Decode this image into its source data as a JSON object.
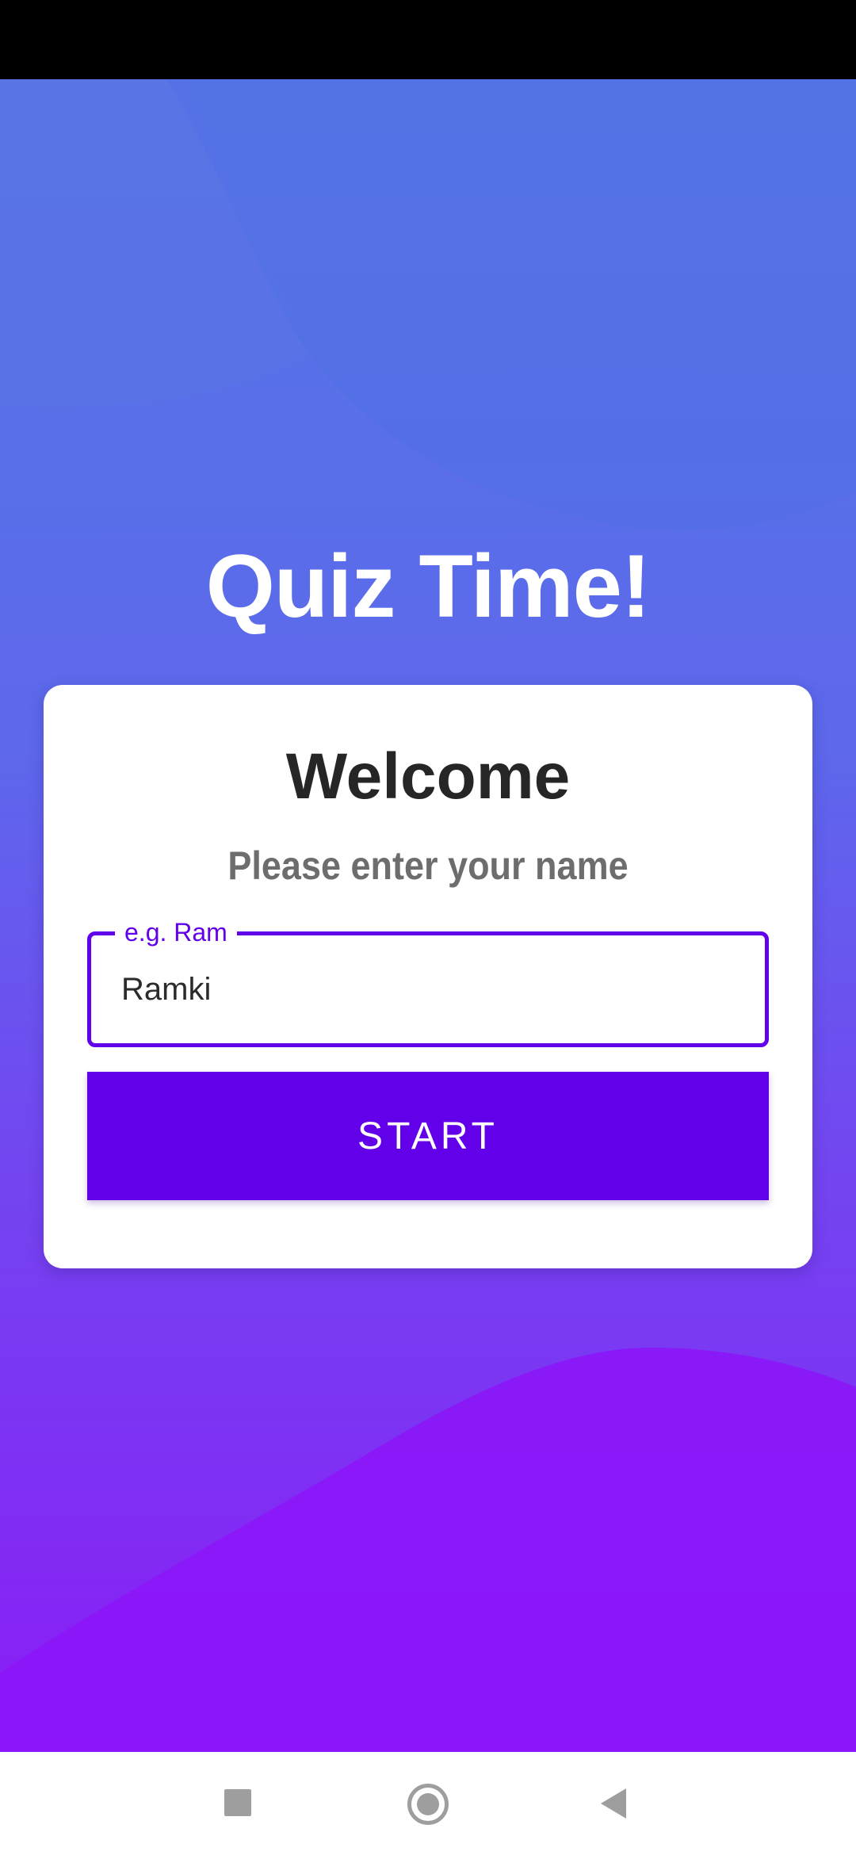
{
  "app": {
    "title": "Quiz Time!"
  },
  "card": {
    "heading": "Welcome",
    "subtitle": "Please enter your name",
    "name_field": {
      "label": "e.g. Ram",
      "value": "Ramki"
    },
    "start_button": "START"
  },
  "nav_bar": {
    "icons": [
      "recent-apps-icon",
      "home-icon",
      "back-icon"
    ]
  },
  "colors": {
    "accent": "#6200ea",
    "background_top": "#5577e4",
    "background_bottom": "#8a1cf6",
    "card": "#ffffff",
    "heading_text": "#262626",
    "subtitle_text": "#6d6d6d"
  }
}
